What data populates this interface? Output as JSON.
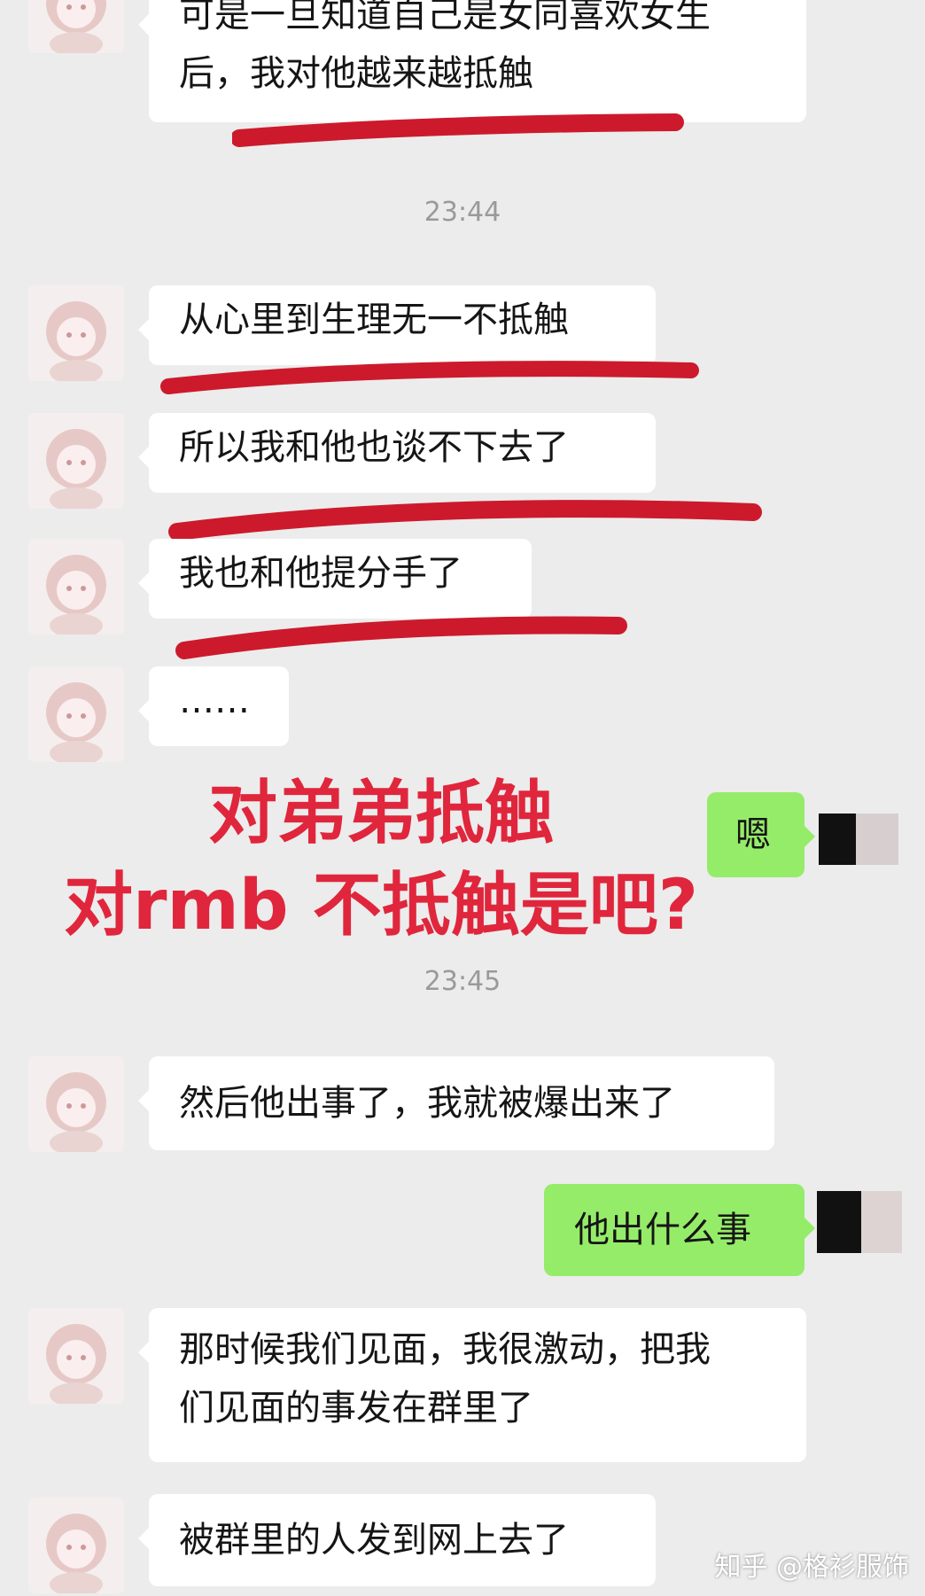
{
  "messages": [
    {
      "side": "left",
      "lines": [
        "可是一旦知道自己是女同喜欢女生",
        "后，我对他越来越抵触"
      ]
    },
    {
      "side": "left",
      "text": "从心里到生理无一不抵触"
    },
    {
      "side": "left",
      "text": "所以我和他也谈不下去了"
    },
    {
      "side": "left",
      "text": "我也和他提分手了"
    },
    {
      "side": "left",
      "text": "……"
    },
    {
      "side": "right",
      "text": "嗯"
    },
    {
      "side": "left",
      "text": "然后他出事了，我就被爆出来了"
    },
    {
      "side": "right",
      "text": "他出什么事"
    },
    {
      "side": "left",
      "lines": [
        "那时候我们见面，我很激动，把我",
        "们见面的事发在群里了"
      ]
    },
    {
      "side": "left",
      "text": "被群里的人发到网上去了"
    }
  ],
  "timestamps": [
    "23:44",
    "23:45"
  ],
  "annotation": {
    "line1": "对弟弟抵触",
    "line2": "对rmb 不抵触是吧?"
  },
  "watermark": "知乎 @格衫服饰",
  "colors": {
    "background": "#ececec",
    "bubble_left": "#ffffff",
    "bubble_right": "#95ec69",
    "underline": "#cc1a2c",
    "annotation": "#e0263c"
  }
}
